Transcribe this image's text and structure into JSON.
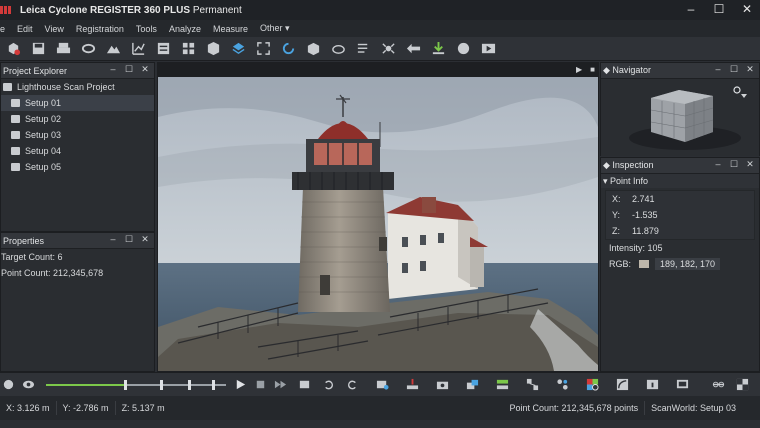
{
  "window": {
    "title_brand": "Leica Cyclone REGISTER 360 PLUS",
    "title_license": "Permanent",
    "controls": [
      "–",
      "☐",
      "✕"
    ]
  },
  "menu": [
    "e",
    "Edit",
    "View",
    "Registration",
    "Tools",
    "Analyze",
    "Measure",
    "Other ▾"
  ],
  "toolbar_icons": [
    "add-setup-icon",
    "save-icon",
    "print-icon",
    "link-icon",
    "mountain-icon",
    "chart-icon",
    "report-icon",
    "grid-icon",
    "cube-icon",
    "layers-icon",
    "fit-icon",
    "rotate-icon",
    "box-icon",
    "cloud-icon",
    "list-edit-icon",
    "bug-icon",
    "arrow-icon",
    "download-icon",
    "sphere-icon",
    "play-icon"
  ],
  "project_explorer": {
    "title": "Project Explorer",
    "project": "Lighthouse Scan Project",
    "setups": [
      "Setup 01",
      "Setup 02",
      "Setup 03",
      "Setup 04",
      "Setup 05"
    ],
    "selected_index": 0
  },
  "properties": {
    "title": "Properties",
    "target_count_label": "Target Count: 6",
    "point_count_label": "Point Count: 212,345,678"
  },
  "navigator": {
    "title": "Navigator"
  },
  "inspection": {
    "title": "Inspection",
    "section": "Point Info",
    "x_label": "X:",
    "x_value": "2.741",
    "y_label": "Y:",
    "y_value": "-1.535",
    "z_label": "Z:",
    "z_value": "11.879",
    "intensity": "Intensity: 105",
    "rgb_label": "RGB:",
    "rgb_value": "189,  182,  170",
    "rgb_color": "#bdb6aa"
  },
  "playback": {
    "progress": 0.44,
    "accent": "#7cc84a"
  },
  "status": {
    "x": "X: 3.126 m",
    "y": "Y: -2.786 m",
    "z": "Z: 5.137 m",
    "point_count": "Point Count: 212,345,678 points",
    "scanworld": "ScanWorld:  Setup 03"
  }
}
